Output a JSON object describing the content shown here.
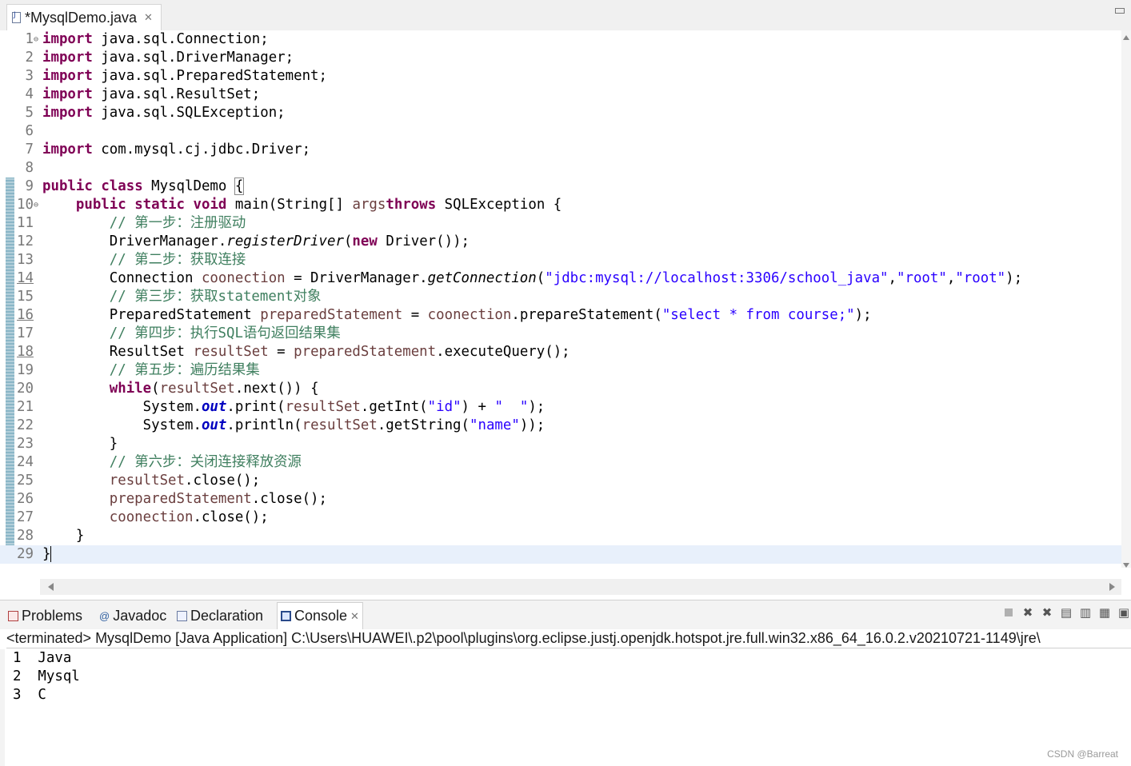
{
  "editor": {
    "tab_title": "*MysqlDemo.java",
    "tab_close": "✕"
  },
  "code": {
    "lines": [
      {
        "n": "1",
        "fold": "⊖",
        "parts": [
          [
            "kw",
            "import"
          ],
          [
            "",
            " java.sql.Connection;"
          ]
        ]
      },
      {
        "n": "2",
        "parts": [
          [
            "kw",
            "import"
          ],
          [
            "",
            " java.sql.DriverManager;"
          ]
        ]
      },
      {
        "n": "3",
        "parts": [
          [
            "kw",
            "import"
          ],
          [
            "",
            " java.sql.PreparedStatement;"
          ]
        ]
      },
      {
        "n": "4",
        "parts": [
          [
            "kw",
            "import"
          ],
          [
            "",
            " java.sql.ResultSet;"
          ]
        ]
      },
      {
        "n": "5",
        "parts": [
          [
            "kw",
            "import"
          ],
          [
            "",
            " java.sql.SQLException;"
          ]
        ]
      },
      {
        "n": "6",
        "parts": []
      },
      {
        "n": "7",
        "parts": [
          [
            "kw",
            "import"
          ],
          [
            "",
            " com.mysql.cj.jdbc.Driver;"
          ]
        ]
      },
      {
        "n": "8",
        "parts": []
      },
      {
        "n": "9",
        "parts": [
          [
            "kw",
            "public"
          ],
          [
            "",
            " "
          ],
          [
            "kw",
            "class"
          ],
          [
            "",
            " MysqlDemo "
          ],
          [
            "brace-box",
            "{"
          ]
        ]
      },
      {
        "n": "10",
        "fold": "⊖",
        "parts": [
          [
            "",
            "    "
          ],
          [
            "kw",
            "public"
          ],
          [
            "",
            " "
          ],
          [
            "kw",
            "static"
          ],
          [
            "",
            " "
          ],
          [
            "kw",
            "void"
          ],
          [
            "",
            " main(String[] "
          ],
          [
            "var",
            "args"
          ],
          [
            ") "
          ],
          [
            "kw",
            "throws"
          ],
          [
            "",
            " SQLException {"
          ]
        ]
      },
      {
        "n": "11",
        "parts": [
          [
            "",
            "        "
          ],
          [
            "cm",
            "// "
          ],
          [
            "cm cn",
            "第一步：注册驱动"
          ]
        ]
      },
      {
        "n": "12",
        "parts": [
          [
            "",
            "        DriverManager."
          ],
          [
            "smeth",
            "registerDriver"
          ],
          [
            "",
            "("
          ],
          [
            "kw",
            "new"
          ],
          [
            "",
            " Driver());"
          ]
        ]
      },
      {
        "n": "13",
        "parts": [
          [
            "",
            "        "
          ],
          [
            "cm",
            "// "
          ],
          [
            "cm cn",
            "第二步：获取连接"
          ]
        ]
      },
      {
        "n": "14",
        "changed": true,
        "parts": [
          [
            "",
            "        Connection "
          ],
          [
            "var",
            "coonection"
          ],
          [
            "",
            " = DriverManager."
          ],
          [
            "smeth",
            "getConnection"
          ],
          [
            "",
            "("
          ],
          [
            "str",
            "\"jdbc:mysql://localhost:3306/school_java\""
          ],
          [
            "",
            ","
          ],
          [
            "str",
            "\"root\""
          ],
          [
            "",
            ","
          ],
          [
            "str",
            "\"root\""
          ],
          [
            "",
            ");"
          ]
        ]
      },
      {
        "n": "15",
        "parts": [
          [
            "",
            "        "
          ],
          [
            "cm",
            "// "
          ],
          [
            "cm cn",
            "第三步：获取"
          ],
          [
            "cm",
            "statement"
          ],
          [
            "cm cn",
            "对象"
          ]
        ]
      },
      {
        "n": "16",
        "changed": true,
        "parts": [
          [
            "",
            "        PreparedStatement "
          ],
          [
            "var",
            "preparedStatement"
          ],
          [
            "",
            " = "
          ],
          [
            "var",
            "coonection"
          ],
          [
            "",
            ".prepareStatement("
          ],
          [
            "str",
            "\"select * from course;\""
          ],
          [
            "",
            ");"
          ]
        ]
      },
      {
        "n": "17",
        "parts": [
          [
            "",
            "        "
          ],
          [
            "cm",
            "// "
          ],
          [
            "cm cn",
            "第四步：执行"
          ],
          [
            "cm",
            "SQL"
          ],
          [
            "cm cn",
            "语句返回结果集"
          ]
        ]
      },
      {
        "n": "18",
        "changed": true,
        "parts": [
          [
            "",
            "        ResultSet "
          ],
          [
            "var",
            "resultSet"
          ],
          [
            "",
            " = "
          ],
          [
            "var",
            "preparedStatement"
          ],
          [
            "",
            ".executeQuery();"
          ]
        ]
      },
      {
        "n": "19",
        "parts": [
          [
            "",
            "        "
          ],
          [
            "cm",
            "// "
          ],
          [
            "cm cn",
            "第五步：遍历结果集"
          ]
        ]
      },
      {
        "n": "20",
        "parts": [
          [
            "",
            "        "
          ],
          [
            "kw",
            "while"
          ],
          [
            "",
            "("
          ],
          [
            "var",
            "resultSet"
          ],
          [
            "",
            ".next()) {"
          ]
        ]
      },
      {
        "n": "21",
        "parts": [
          [
            "",
            "            System."
          ],
          [
            "field",
            "out"
          ],
          [
            "",
            ".print("
          ],
          [
            "var",
            "resultSet"
          ],
          [
            "",
            ".getInt("
          ],
          [
            "str",
            "\"id\""
          ],
          [
            "",
            ") + "
          ],
          [
            "str",
            "\"  \""
          ],
          [
            "",
            ");"
          ]
        ]
      },
      {
        "n": "22",
        "parts": [
          [
            "",
            "            System."
          ],
          [
            "field",
            "out"
          ],
          [
            "",
            ".println("
          ],
          [
            "var",
            "resultSet"
          ],
          [
            "",
            ".getString("
          ],
          [
            "str",
            "\"name\""
          ],
          [
            "",
            "));"
          ]
        ]
      },
      {
        "n": "23",
        "parts": [
          [
            "",
            "        }"
          ]
        ]
      },
      {
        "n": "24",
        "parts": [
          [
            "",
            "        "
          ],
          [
            "cm",
            "// "
          ],
          [
            "cm cn",
            "第六步：关闭连接释放资源"
          ]
        ]
      },
      {
        "n": "25",
        "parts": [
          [
            "",
            "        "
          ],
          [
            "var",
            "resultSet"
          ],
          [
            "",
            ".close();"
          ]
        ]
      },
      {
        "n": "26",
        "parts": [
          [
            "",
            "        "
          ],
          [
            "var",
            "preparedStatement"
          ],
          [
            "",
            ".close();"
          ]
        ]
      },
      {
        "n": "27",
        "parts": [
          [
            "",
            "        "
          ],
          [
            "var",
            "coonection"
          ],
          [
            "",
            ".close();"
          ]
        ]
      },
      {
        "n": "28",
        "parts": [
          [
            "",
            "    }"
          ]
        ]
      },
      {
        "n": "29",
        "current": true,
        "parts": [
          [
            "",
            "}"
          ],
          [
            "caret",
            ""
          ]
        ]
      }
    ]
  },
  "panel": {
    "tabs": [
      {
        "label": "Problems",
        "name": "tab-problems",
        "icon": "problems-icon"
      },
      {
        "label": "Javadoc",
        "name": "tab-javadoc",
        "icon": "javadoc-icon"
      },
      {
        "label": "Declaration",
        "name": "tab-declaration",
        "icon": "declaration-icon"
      },
      {
        "label": "Console",
        "name": "tab-console",
        "icon": "console-icon",
        "active": true
      }
    ],
    "console_close": "✕",
    "console_header": "<terminated> MysqlDemo [Java Application] C:\\Users\\HUAWEI\\.p2\\pool\\plugins\\org.eclipse.justj.openjdk.hotspot.jre.full.win32.x86_64_16.0.2.v20210721-1149\\jre\\",
    "output": [
      "1  Java",
      "2  Mysql",
      "3  C"
    ]
  },
  "watermark": "CSDN @Barreat",
  "javadoc_glyph": "@"
}
